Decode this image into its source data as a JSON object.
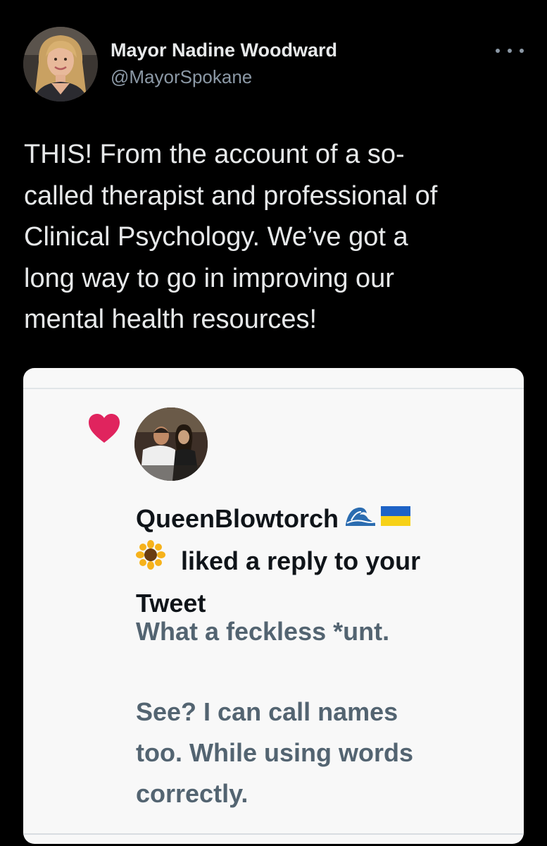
{
  "tweet": {
    "author": {
      "display_name": "Mayor Nadine Woodward",
      "handle": "@MayorSpokane",
      "avatar_icon": "profile-photo-woman-blonde"
    },
    "more_icon": "ellipsis-icon",
    "text_lines": [
      "THIS! From the account of a so-",
      "called therapist and professional of",
      "Clinical Psychology. We’ve got a",
      "long way to go in improving our",
      "mental health resources!"
    ]
  },
  "embedded_screenshot": {
    "notification": {
      "heart_icon": "heart-icon",
      "heart_color": "#e0245e",
      "user_name": "QueenBlowtorch",
      "name_emojis": [
        "wave-emoji",
        "ukraine-flag-emoji"
      ],
      "action_emoji": "sunflower-emoji",
      "action_text_line1": "liked a reply to your",
      "action_text_line2": "Tweet"
    },
    "reply_lines": [
      "What a feckless *unt.",
      "See?  I can call names",
      "too.  While using words",
      "correctly."
    ]
  },
  "colors": {
    "background": "#000000",
    "text_primary": "#e7e9ea",
    "text_secondary": "#8b98a5",
    "card_background": "#f8f8f8",
    "card_text_dark": "#0f1419",
    "card_text_gray": "#536471"
  }
}
